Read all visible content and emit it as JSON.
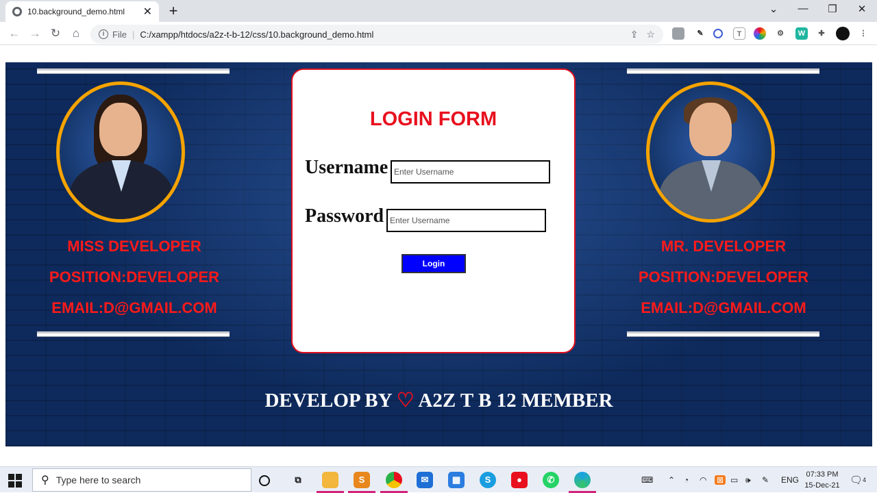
{
  "browser": {
    "tab_title": "10.background_demo.html",
    "new_tab_symbol": "+",
    "close_symbol": "✕",
    "window_controls": {
      "chevron": "⌄",
      "minimize": "—",
      "maximize": "❐",
      "close": "✕"
    },
    "nav": {
      "back": "←",
      "forward": "→",
      "reload": "↻",
      "home": "⌂"
    },
    "address": {
      "scheme_label": "File",
      "url": "C:/xampp/htdocs/a2z-t-b-12/css/10.background_demo.html"
    },
    "extensions": [
      "shield-icon",
      "pen-icon",
      "block-icon",
      "text-icon",
      "color-wheel-icon",
      "gear-icon",
      "w-icon",
      "puzzle-icon",
      "profile-icon"
    ]
  },
  "page": {
    "left_profile": {
      "name": "MISS DEVELOPER",
      "position": "POSITION:DEVELOPER",
      "email": "EMAIL:D@GMAIL.COM"
    },
    "right_profile": {
      "name": "MR. DEVELOPER",
      "position": "POSITION:DEVELOPER",
      "email": "EMAIL:D@GMAIL.COM"
    },
    "login": {
      "title": "LOGIN FORM",
      "username_label": "Username",
      "username_placeholder": "Enter Username",
      "password_label": "Password",
      "password_placeholder": "Enter Username",
      "button_label": "Login"
    },
    "footer": {
      "before_heart": "DEVELOP BY ",
      "heart": "♡",
      "after_heart": " A2Z T B 12 MEMBER"
    },
    "colors": {
      "accent_red": "#e8101e",
      "ring_orange": "#f5a300",
      "button_blue": "#0000ff",
      "background_navy": "#0e2a5c"
    }
  },
  "taskbar": {
    "search_placeholder": "Type here to search",
    "apps": [
      "task-view-icon",
      "file-explorer-icon",
      "sublime-icon",
      "chrome-icon",
      "mail-icon",
      "store-icon",
      "skype-icon",
      "recorder-icon",
      "whatsapp-icon",
      "edge-icon"
    ],
    "language": "ENG",
    "time": "07:33 PM",
    "date": "15-Dec-21",
    "notification_count": "4"
  }
}
